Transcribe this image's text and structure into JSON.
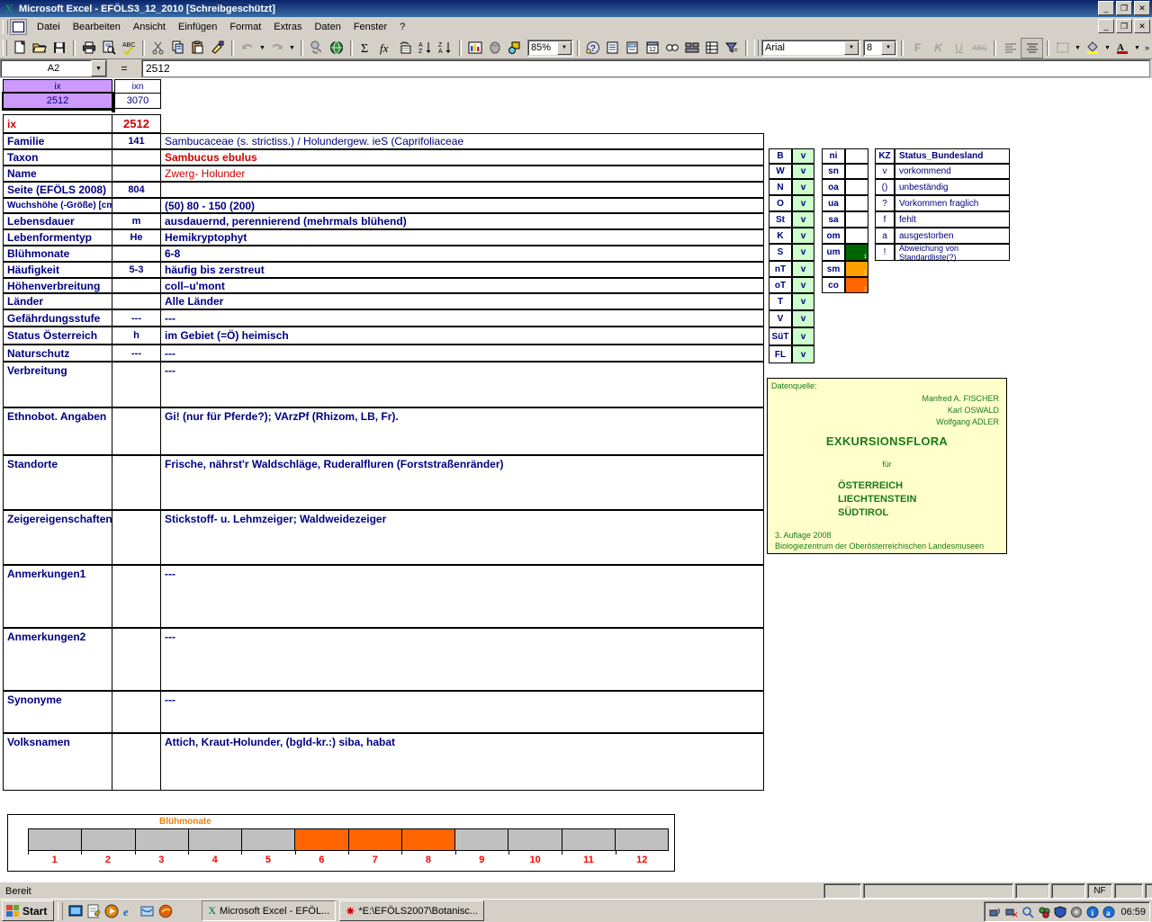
{
  "window": {
    "title": "Microsoft Excel - EFÖLS3_12_2010  [Schreibgeschützt]",
    "app_icon": "excel-icon",
    "minimize": "_",
    "maximize": "❐",
    "close": "✕"
  },
  "menu": {
    "items": [
      {
        "label": "Datei"
      },
      {
        "label": "Bearbeiten"
      },
      {
        "label": "Ansicht"
      },
      {
        "label": "Einfügen"
      },
      {
        "label": "Format"
      },
      {
        "label": "Extras"
      },
      {
        "label": "Daten"
      },
      {
        "label": "Fenster"
      },
      {
        "label": "?"
      }
    ]
  },
  "toolbar": {
    "zoom": "85%",
    "font_name": "Arial",
    "font_size": "8",
    "bold": "F",
    "italic": "K",
    "underline": "U",
    "strike": "ABC"
  },
  "formula_bar": {
    "name_box": "A2",
    "equals": "=",
    "content": "2512"
  },
  "mini_table": {
    "headers": [
      "ix",
      "ixn"
    ],
    "values": [
      "2512",
      "3070"
    ]
  },
  "id_row": {
    "label": "ix",
    "value": "2512"
  },
  "rows": [
    {
      "label": "Familie",
      "code": "141",
      "value": "Sambucaceae (s. strictiss.)  /  Holundergew. ieS (Caprifoliaceae",
      "style": "plain"
    },
    {
      "label": "Taxon",
      "code": "",
      "value": "Sambucus ebulus",
      "style": "redbold"
    },
    {
      "label": "Name",
      "code": "",
      "value": "Zwerg- Holunder",
      "style": "red"
    },
    {
      "label": "Seite (EFÖLS 2008)",
      "code": "804",
      "value": "",
      "style": "bold"
    },
    {
      "label": "Wuchshöhe (-Größe) [cm]",
      "code": "",
      "value": " (50) 80 - 150 (200)",
      "style": "bold"
    },
    {
      "label": "Lebensdauer",
      "code": "m",
      "value": "ausdauernd, perennierend (mehrmals blühend)",
      "style": "bold"
    },
    {
      "label": "Lebenformentyp",
      "code": "He",
      "value": "Hemikryptophyt",
      "style": "bold"
    },
    {
      "label": "Blühmonate",
      "code": "",
      "value": " 6-8",
      "style": "bold"
    },
    {
      "label": "Häufigkeit",
      "code": "5-3",
      "value": "häufig bis zerstreut",
      "style": "bold"
    },
    {
      "label": "Höhenverbreitung",
      "code": "",
      "value": "coll–u'mont",
      "style": "bold"
    },
    {
      "label": "Länder",
      "code": "",
      "value": "Alle Länder",
      "style": "bold"
    },
    {
      "label": "Gefährdungsstufe",
      "code": "---",
      "value": " ---",
      "style": "bold"
    },
    {
      "label": "Status Österreich",
      "code": "h",
      "value": "im Gebiet (=Ö) heimisch",
      "style": "bold"
    },
    {
      "label": "Naturschutz",
      "code": "---",
      "value": "---",
      "style": "bold"
    }
  ],
  "tall_rows": [
    {
      "label": "Verbreitung",
      "code": "",
      "value": "---"
    },
    {
      "label": "Ethnobot. Angaben",
      "code": "",
      "value": "Gi! (nur für Pferde?); VArzPf (Rhizom, LB, Fr)."
    },
    {
      "label": "Standorte",
      "code": "",
      "value": "Frische, nährst'r Waldschläge, Ruderalfluren (Forststraßenränder)"
    },
    {
      "label": "Zeigereigenschaften",
      "code": "",
      "value": "Stickstoff- u. Lehmzeiger; Waldweidezeiger"
    },
    {
      "label": "Anmerkungen1",
      "code": "",
      "value": "---"
    },
    {
      "label": "Anmerkungen2",
      "code": "",
      "value": "---"
    },
    {
      "label": "Synonyme",
      "code": "",
      "value": "---"
    },
    {
      "label": "Volksnamen",
      "code": "",
      "value": "Attich, Kraut-Holunder, (bgld-kr.:) siba, habat"
    }
  ],
  "bundesland_codes": [
    {
      "code": "B",
      "status": "v"
    },
    {
      "code": "W",
      "status": "v"
    },
    {
      "code": "N",
      "status": "v"
    },
    {
      "code": "O",
      "status": "v"
    },
    {
      "code": "St",
      "status": "v"
    },
    {
      "code": "K",
      "status": "v"
    },
    {
      "code": "S",
      "status": "v"
    },
    {
      "code": "nT",
      "status": "v"
    },
    {
      "code": "oT",
      "status": "v"
    },
    {
      "code": "T",
      "status": "v"
    },
    {
      "code": "V",
      "status": "v"
    },
    {
      "code": "SüT",
      "status": "v"
    },
    {
      "code": "FL",
      "status": "v"
    }
  ],
  "zone_codes": [
    {
      "code": "ni",
      "value": "",
      "color": ""
    },
    {
      "code": "sn",
      "value": "",
      "color": ""
    },
    {
      "code": "oa",
      "value": "",
      "color": ""
    },
    {
      "code": "ua",
      "value": "",
      "color": ""
    },
    {
      "code": "sa",
      "value": "",
      "color": ""
    },
    {
      "code": "om",
      "value": "",
      "color": ""
    },
    {
      "code": "um",
      "value": "1",
      "color": "#006600"
    },
    {
      "code": "sm",
      "value": "1",
      "color": "#ffa000"
    },
    {
      "code": "co",
      "value": "1",
      "color": "#ff6600"
    }
  ],
  "legend": {
    "header_kz": "KZ",
    "header_status": "Status_Bundesland",
    "entries": [
      {
        "kz": "v",
        "desc": "vorkommend"
      },
      {
        "kz": "()",
        "desc": "unbeständig"
      },
      {
        "kz": "?",
        "desc": "Vorkommen fraglich"
      },
      {
        "kz": "f",
        "desc": "fehlt"
      },
      {
        "kz": "a",
        "desc": "ausgestorben"
      },
      {
        "kz": "!",
        "desc": "Abweichung von Standardliste(?)"
      }
    ]
  },
  "datenquelle": {
    "title": "Datenquelle:",
    "authors": [
      "Manfred A. FISCHER",
      "Karl OSWALD",
      "Wolfgang ADLER"
    ],
    "main_title": "EXKURSIONSFLORA",
    "fuer": "für",
    "countries": [
      "ÖSTERREICH",
      "LIECHTENSTEIN",
      "SÜDTIROL"
    ],
    "edition": "3. Auflage 2008",
    "publisher": "Biologiezentrum der Oberösterreichischen Landesmuseen"
  },
  "chart_data": {
    "type": "bar",
    "title": "Blühmonate",
    "categories": [
      "1",
      "2",
      "3",
      "4",
      "5",
      "6",
      "7",
      "8",
      "9",
      "10",
      "11",
      "12"
    ],
    "values": [
      0,
      0,
      0,
      0,
      0,
      1,
      1,
      1,
      0,
      0,
      0,
      0
    ],
    "xlabel": "",
    "ylabel": "",
    "ylim": [
      0,
      1
    ],
    "active_color": "#ff6600",
    "inactive_color": "#c0c0c0",
    "label_color": "#ff0000",
    "title_color": "#e8820c",
    "grid": false,
    "legend": "none"
  },
  "status_bar": {
    "message": "Bereit",
    "indicators": [
      "",
      "",
      "",
      "",
      "NF",
      "",
      "",
      ""
    ]
  },
  "taskbar": {
    "start_label": "Start",
    "quick_icons": [
      "desktop-icon",
      "notes-icon",
      "media-player-icon",
      "internet-explorer-icon",
      "explorer-icon",
      "firefox-icon"
    ],
    "tasks": [
      {
        "icon": "excel-icon",
        "label": "Microsoft Excel - EFÖL..."
      },
      {
        "icon": "acrobat-icon",
        "label": "*E:\\EFÖLS2007\\Botanisc..."
      }
    ],
    "tray_icons": [
      "network-icon",
      "network-disconnected-icon",
      "search-icon",
      "sync-error-icon",
      "shield-icon",
      "volume-icon",
      "info-icon",
      "adobe-icon"
    ],
    "clock": "06:59"
  }
}
